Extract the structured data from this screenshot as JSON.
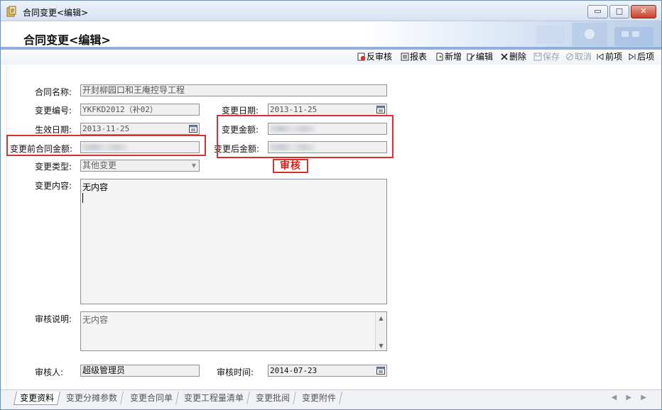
{
  "window": {
    "title": "合同变更<编辑>",
    "controls": {
      "minimize": "▭",
      "maximize": "□",
      "close": "✕"
    }
  },
  "header": {
    "title": "合同变更<编辑>"
  },
  "toolbar": {
    "items": [
      {
        "label": "反审核",
        "icon": "unaudit-icon",
        "enabled": true
      },
      {
        "label": "报表",
        "icon": "report-icon",
        "enabled": true
      },
      {
        "label": "新增",
        "icon": "new-icon",
        "enabled": true
      },
      {
        "label": "编辑",
        "icon": "edit-icon",
        "enabled": true
      },
      {
        "label": "删除",
        "icon": "delete-icon",
        "enabled": true
      },
      {
        "label": "保存",
        "icon": "save-icon",
        "enabled": false
      },
      {
        "label": "取消",
        "icon": "cancel-icon",
        "enabled": false
      },
      {
        "label": "前项",
        "icon": "prev-icon",
        "enabled": true
      },
      {
        "label": "后项",
        "icon": "next-icon",
        "enabled": true
      }
    ]
  },
  "form": {
    "contract_name": {
      "label": "合同名称:",
      "value": "开封柳园口和王庵控导工程"
    },
    "change_no": {
      "label": "变更编号:",
      "value": "YKFKD2012（补02）"
    },
    "change_date": {
      "label": "变更日期:",
      "value": "2013-11-25"
    },
    "effective_date": {
      "label": "生效日期:",
      "value": "2013-11-25"
    },
    "change_amount": {
      "label": "变更金额:",
      "value": ""
    },
    "amount_before": {
      "label": "变更前合同金额:",
      "value": ""
    },
    "amount_after": {
      "label": "变更后金额:",
      "value": ""
    },
    "change_type": {
      "label": "变更类型:",
      "value": "其他变更",
      "arrow": "▼"
    },
    "change_content": {
      "label": "变更内容:",
      "value": "无内容"
    },
    "audit_note": {
      "label": "审核说明:",
      "value": "无内容"
    },
    "auditor": {
      "label": "审核人:",
      "value": "超级管理员"
    },
    "audit_time": {
      "label": "审核时间:",
      "value": "2014-07-23"
    }
  },
  "stamp": {
    "text": "审核",
    "color": "#d4231c"
  },
  "tabs": [
    {
      "label": "变更资料",
      "active": true
    },
    {
      "label": "变更分摊参数",
      "active": false
    },
    {
      "label": "变更合同单",
      "active": false
    },
    {
      "label": "变更工程量清单",
      "active": false
    },
    {
      "label": "变更批阅",
      "active": false
    },
    {
      "label": "变更附件",
      "active": false
    }
  ],
  "tab_nav": "◀ ▶ ▶",
  "colors": {
    "accent_bar": "#8fb0dc",
    "highlight_red": "#d9322e"
  }
}
